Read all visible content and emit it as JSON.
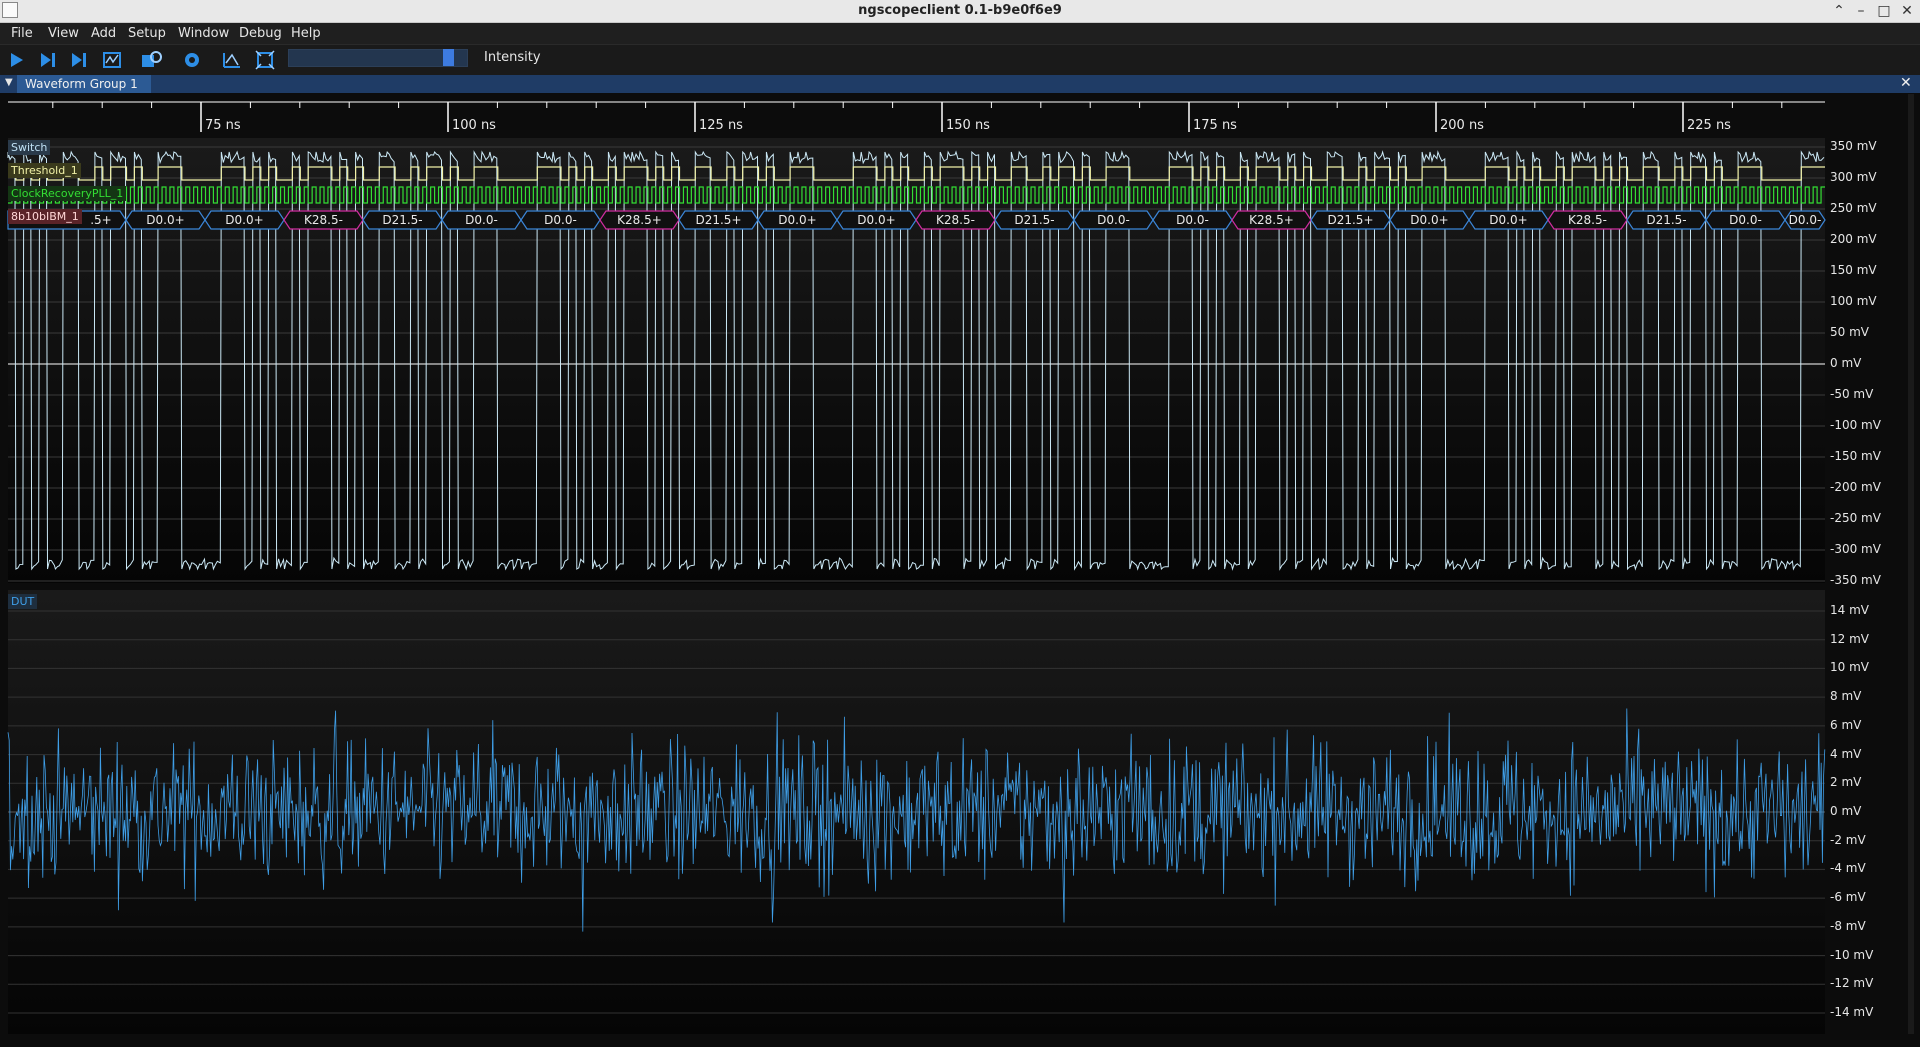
{
  "window": {
    "title": "ngscopeclient 0.1-b9e0f6e9",
    "controls": [
      "minimize-icon",
      "maximize-icon",
      "close-icon"
    ]
  },
  "menu": [
    "File",
    "View",
    "Add",
    "Setup",
    "Window",
    "Debug",
    "Help"
  ],
  "toolbar": {
    "buttons": [
      "trigger-run-icon",
      "trigger-single-icon",
      "trigger-force-icon",
      "history-icon",
      "refresh-settings-icon",
      "timebase-settings-icon",
      "measure-icon",
      "fullscreen-icon"
    ],
    "intensity_label": "Intensity",
    "intensity": 0.87
  },
  "group": {
    "title": "Waveform Group 1"
  },
  "timeline": {
    "unit": "ns",
    "ticks": [
      "75 ns",
      "100 ns",
      "125 ns",
      "150 ns",
      "175 ns",
      "200 ns",
      "225 ns"
    ]
  },
  "switch_panel": {
    "name": "Switch",
    "channels": {
      "threshold": "Threshold_1",
      "clock": "ClockRecoveryPLL_1",
      "decode": "8b10bIBM_1",
      "decode_first_partial": ".5+"
    },
    "axis": [
      "350 mV",
      "300 mV",
      "250 mV",
      "200 mV",
      "150 mV",
      "100 mV",
      "50 mV",
      "0 mV",
      "-50 mV",
      "-100 mV",
      "-150 mV",
      "-200 mV",
      "-250 mV",
      "-300 mV",
      "-350 mV"
    ],
    "symbols": [
      {
        "t": "D0.0+",
        "k": false
      },
      {
        "t": "D0.0+",
        "k": false
      },
      {
        "t": "K28.5-",
        "k": true
      },
      {
        "t": "D21.5-",
        "k": false
      },
      {
        "t": "D0.0-",
        "k": false
      },
      {
        "t": "D0.0-",
        "k": false
      },
      {
        "t": "K28.5+",
        "k": true
      },
      {
        "t": "D21.5+",
        "k": false
      },
      {
        "t": "D0.0+",
        "k": false
      },
      {
        "t": "D0.0+",
        "k": false
      },
      {
        "t": "K28.5-",
        "k": true
      },
      {
        "t": "D21.5-",
        "k": false
      },
      {
        "t": "D0.0-",
        "k": false
      },
      {
        "t": "D0.0-",
        "k": false
      },
      {
        "t": "K28.5+",
        "k": true
      },
      {
        "t": "D21.5+",
        "k": false
      },
      {
        "t": "D0.0+",
        "k": false
      },
      {
        "t": "D0.0+",
        "k": false
      },
      {
        "t": "K28.5-",
        "k": true
      },
      {
        "t": "D21.5-",
        "k": false
      },
      {
        "t": "D0.0-",
        "k": false
      },
      {
        "t": "D0.0-",
        "k": false
      }
    ]
  },
  "dut_panel": {
    "name": "DUT",
    "axis": [
      "14 mV",
      "12 mV",
      "10 mV",
      "8 mV",
      "6 mV",
      "4 mV",
      "2 mV",
      "0 mV",
      "-2 mV",
      "-4 mV",
      "-6 mV",
      "-8 mV",
      "-10 mV",
      "-12 mV",
      "-14 mV"
    ]
  },
  "colors": {
    "analog": "#cbe8f5",
    "threshold": "#f2f2a8",
    "clock": "#33dd33",
    "decode_data": "#3b86d8",
    "decode_ctrl": "#d02ca0",
    "dut": "#3f9fe8",
    "ruler": "#ffffff"
  }
}
